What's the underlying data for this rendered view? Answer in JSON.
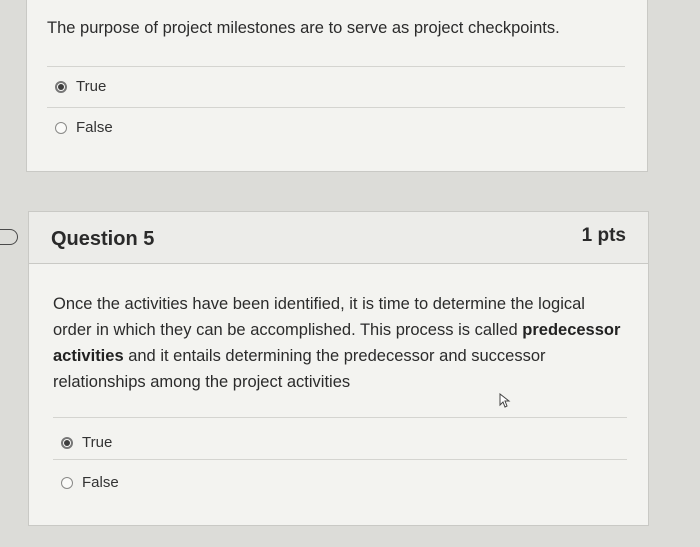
{
  "question4": {
    "text": "The purpose of project milestones are to serve as project checkpoints.",
    "answers": [
      {
        "label": "True",
        "selected": true
      },
      {
        "label": "False",
        "selected": false
      }
    ]
  },
  "question5": {
    "title": "Question 5",
    "points": "1 pts",
    "text_part1": "Once the activities have been identified, it is time to determine the logical order in which they can be accomplished. This process is called ",
    "text_bold": "predecessor activities",
    "text_part2": " and it entails determining the predecessor and successor relationships among the project activities",
    "answers": [
      {
        "label": "True",
        "selected": true
      },
      {
        "label": "False",
        "selected": false
      }
    ]
  },
  "icons": {
    "flag": "question-marker-icon",
    "cursor": "mouse-pointer-icon"
  }
}
